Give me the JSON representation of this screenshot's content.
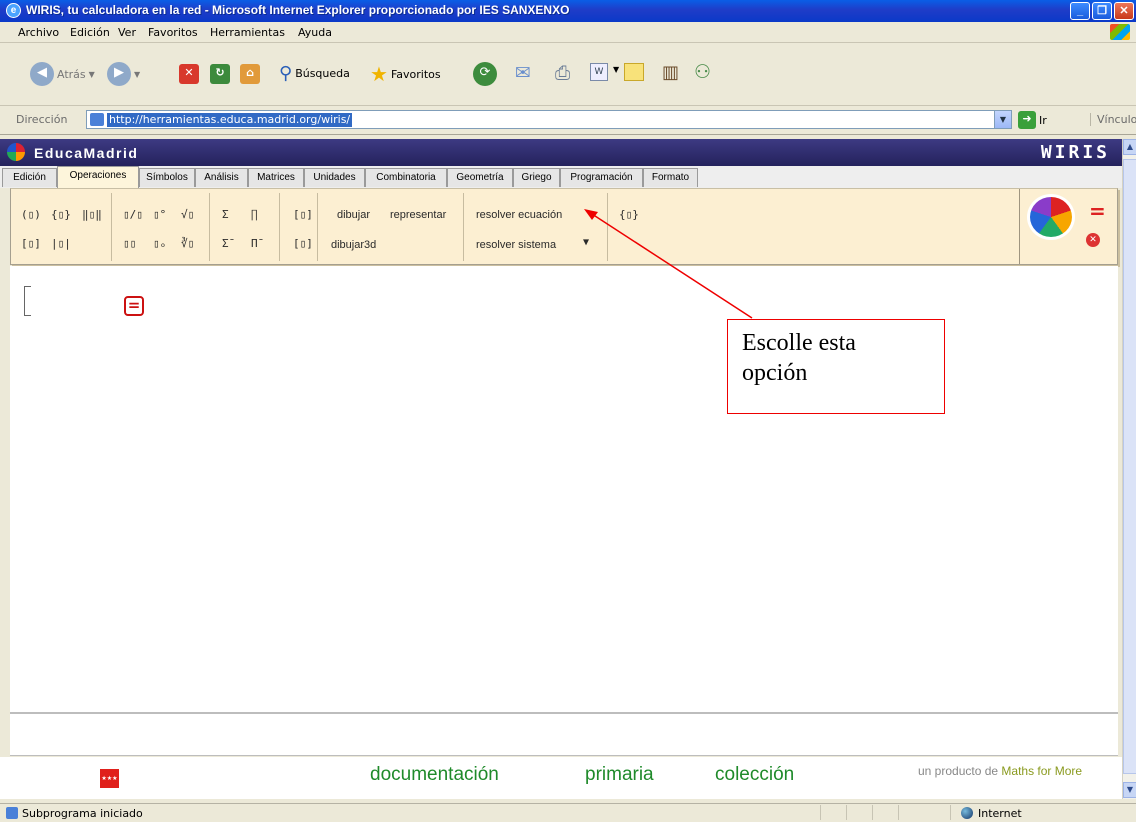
{
  "window": {
    "title": "WIRIS, tu calculadora en la red - Microsoft Internet Explorer proporcionado por IES SANXENXO",
    "minimize": "_",
    "maximize": "❐",
    "close": "✕"
  },
  "menu": [
    "Archivo",
    "Edición",
    "Ver",
    "Favoritos",
    "Herramientas",
    "Ayuda"
  ],
  "toolbar": {
    "back": "Atrás",
    "search": "Búsqueda",
    "favorites": "Favoritos"
  },
  "address": {
    "label": "Dirección",
    "url": "http://herramientas.educa.madrid.org/wiris/",
    "go": "Ir",
    "links": "Vínculos"
  },
  "site": {
    "brand": "EducaMadrid",
    "product": "WIRIS"
  },
  "tabs": [
    "Edición",
    "Operaciones",
    "Símbolos",
    "Análisis",
    "Matrices",
    "Unidades",
    "Combinatoria",
    "Geometría",
    "Griego",
    "Programación",
    "Formato"
  ],
  "active_tab": "Operaciones",
  "palette": {
    "row1_sym": [
      "(▯)",
      "{▯}",
      "‖▯‖",
      "▯/▯",
      "▯°",
      "√▯",
      "Σ",
      "∏",
      "[▯]"
    ],
    "row2_sym": [
      "[▯]",
      "|▯|",
      "▯▯",
      "▯ₒ",
      "∛▯",
      "Σ̄",
      "Π̄",
      "[▯]"
    ],
    "dibujar": "dibujar",
    "representar": "representar",
    "dibujar3d": "dibujar3d",
    "resolver_ecuacion": "resolver ecuación",
    "resolver_sistema": "resolver sistema",
    "dropdown": "▼",
    "brace_sym": "{▯}",
    "equals": "=",
    "cancel": "✕"
  },
  "workarea": {
    "calc_button": "="
  },
  "annotation": {
    "line1": "Escolle esta",
    "line2": "opción"
  },
  "footer": {
    "madrid_badge": "★★★",
    "links": [
      "documentación",
      "primaria",
      "colección"
    ],
    "credit_prefix": "un producto de",
    "credit_brand": "Maths for More"
  },
  "status": {
    "text": "Subprograma iniciado",
    "zone": "Internet"
  }
}
